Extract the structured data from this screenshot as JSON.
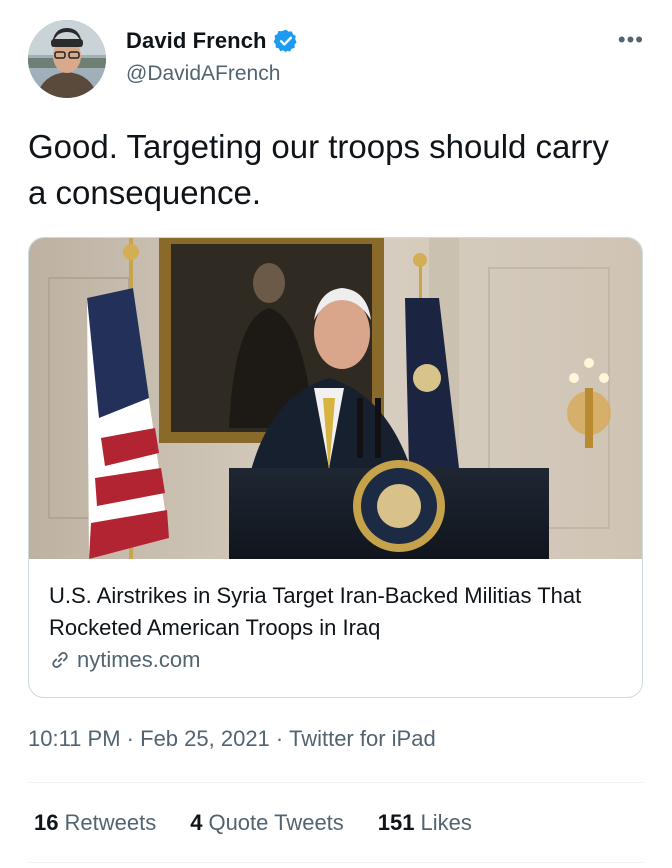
{
  "author": {
    "display_name": "David French",
    "handle": "@DavidAFrench",
    "verified_icon": "verified-badge-icon",
    "verified_color": "#1d9bf0"
  },
  "more_icon": "more-options-icon",
  "tweet": {
    "text": "Good. Targeting our troops should carry a consequence."
  },
  "card": {
    "title": "U.S. Airstrikes in Syria Target Iran-Backed Militias That Rocketed American Troops in Iraq",
    "domain": "nytimes.com",
    "link_icon": "link-icon",
    "image_icon": "press-conference-photo"
  },
  "meta": {
    "time": "10:11 PM",
    "date": "Feb 25, 2021",
    "source": "Twitter for iPad",
    "separator": "·"
  },
  "stats": {
    "retweets_count": "16",
    "retweets_label": "Retweets",
    "quotes_count": "4",
    "quotes_label": "Quote Tweets",
    "likes_count": "151",
    "likes_label": "Likes"
  },
  "colors": {
    "text": "#0f1419",
    "secondary": "#536471",
    "border": "#cfd9de",
    "accent": "#1d9bf0"
  }
}
